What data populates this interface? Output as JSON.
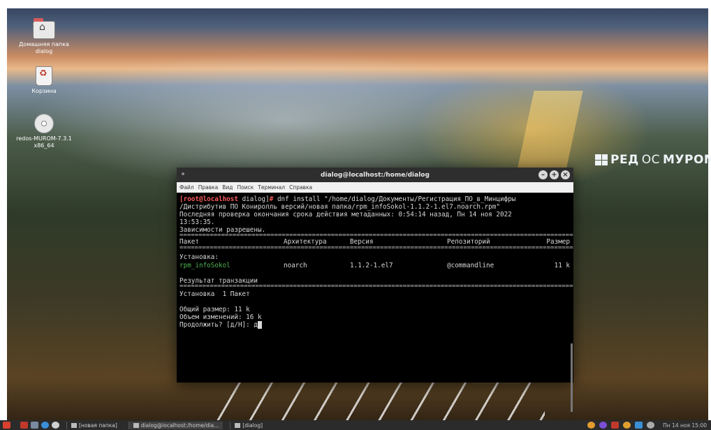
{
  "desktop": {
    "icons": [
      {
        "label": "Домашняя папка dialog"
      },
      {
        "label": "Корзина"
      },
      {
        "label": "redos-MUROM-7.3.1 x86_64"
      }
    ],
    "brand": {
      "prefix": "РЕД",
      "os": "ОС",
      "suffix": "МУРОМ"
    }
  },
  "terminal": {
    "title": "dialog@localhost:/home/dialog",
    "menu": [
      "Файл",
      "Правка",
      "Вид",
      "Поиск",
      "Терминал",
      "Справка"
    ],
    "prompt_user": "[root@localhost",
    "prompt_dir": " dialog]",
    "prompt_hash": "#",
    "command": " dnf install \"/home/dialog/Документы/Регистрация_ПО_в_Минцифры",
    "command_cont": "/Дистрибутив ПО Кониролль версий/новая папка/rpm_infoSokol-1.1.2-1.el7.noarch.rpm\"",
    "metadata_line1": "Последняя проверка окончания срока действия метаданных: 0:54:14 назад, Пн 14 ноя 2022",
    "metadata_line2": "13:53:35.",
    "deps_resolved": "Зависимости разрешены.",
    "table_headers": {
      "package": "Пакет",
      "arch": "Архитектура",
      "version": "Версия",
      "repo": "Репозиторий",
      "size": "Размер"
    },
    "install_heading": "Установка:",
    "package_row": {
      "name": "rpm_infoSokol",
      "arch": "noarch",
      "version": "1.1.2-1.el7",
      "repo": "@commandline",
      "size": "11 k"
    },
    "transaction_result": "Результат транзакции",
    "install_count": "Установка  1 Пакет",
    "total_size": "Общий размер: 11 k",
    "changes_size": "Объем изменений: 16 k",
    "confirm_prompt": "Продолжить? [д/Н]: ",
    "confirm_input": "д"
  },
  "taskbar": {
    "tasks": [
      {
        "label": "[новая папка]"
      },
      {
        "label": "dialog@localhost:/home/dia..."
      },
      {
        "label": "[dialog]"
      }
    ],
    "clock": "Пн 14 ноя 15:00"
  }
}
